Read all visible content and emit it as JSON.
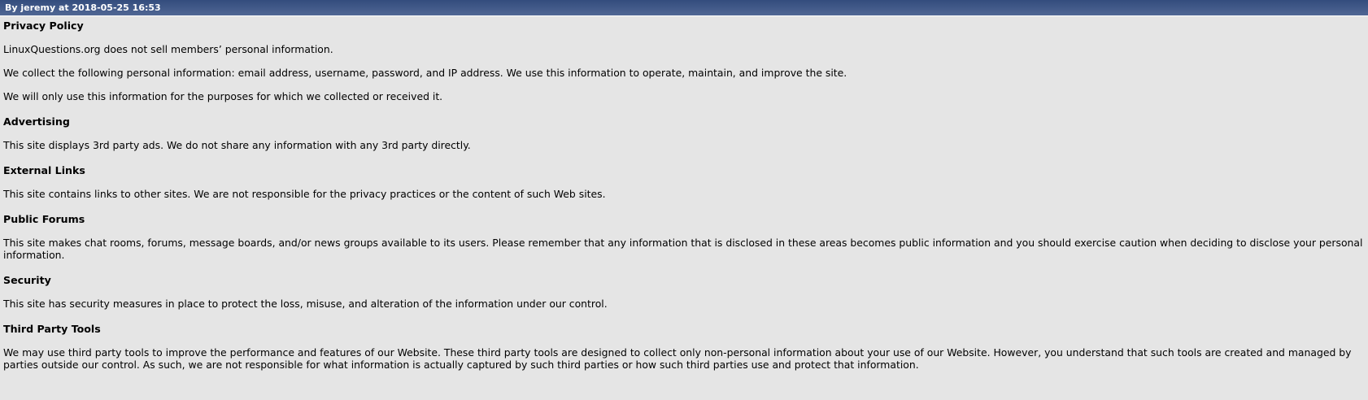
{
  "header": {
    "byline": "By jeremy at 2018-05-25 16:53"
  },
  "colors": {
    "header_top": "#334c7d",
    "header_bottom": "#506794",
    "background": "#e5e5e5"
  },
  "sections": [
    {
      "heading": "Privacy Policy",
      "paragraphs": [
        "LinuxQuestions.org does not sell members’ personal information.",
        "We collect the following personal information: email address, username, password, and IP address. We use this information to operate, maintain, and improve the site.",
        "We will only use this information for the purposes for which we collected or received it."
      ]
    },
    {
      "heading": "Advertising",
      "paragraphs": [
        "This site displays 3rd party ads. We do not share any information with any 3rd party directly."
      ]
    },
    {
      "heading": "External Links",
      "paragraphs": [
        "This site contains links to other sites. We are not responsible for the privacy practices or the content of such Web sites."
      ]
    },
    {
      "heading": "Public Forums",
      "paragraphs": [
        "This site makes chat rooms, forums, message boards, and/or news groups available to its users. Please remember that any information that is disclosed in these areas becomes public information and you should exercise caution when deciding to disclose your personal information."
      ]
    },
    {
      "heading": "Security",
      "paragraphs": [
        "This site has security measures in place to protect the loss, misuse, and alteration of the information under our control."
      ]
    },
    {
      "heading": "Third Party Tools",
      "paragraphs": [
        "We may use third party tools to improve the performance and features of our Website. These third party tools are designed to collect only non-personal information about your use of our Website. However, you understand that such tools are created and managed by parties outside our control. As such, we are not responsible for what information is actually captured by such third parties or how such third parties use and protect that information."
      ]
    }
  ]
}
